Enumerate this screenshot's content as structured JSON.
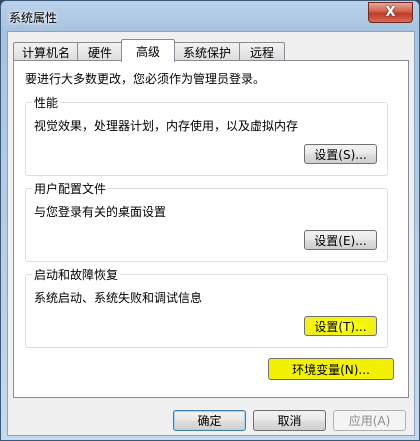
{
  "window": {
    "title": "系统属性",
    "close_glyph": "X"
  },
  "tabs": [
    {
      "label": "计算机名",
      "active": false
    },
    {
      "label": "硬件",
      "active": false
    },
    {
      "label": "高级",
      "active": true
    },
    {
      "label": "系统保护",
      "active": false
    },
    {
      "label": "远程",
      "active": false
    }
  ],
  "advanced": {
    "notice": "要进行大多数更改，您必须作为管理员登录。",
    "performance": {
      "title": "性能",
      "description": "视觉效果，处理器计划，内存使用，以及虚拟内存",
      "button": "设置(S)..."
    },
    "user_profiles": {
      "title": "用户配置文件",
      "description": "与您登录有关的桌面设置",
      "button": "设置(E)..."
    },
    "startup_recovery": {
      "title": "启动和故障恢复",
      "description": "系统启动、系统失败和调试信息",
      "button": "设置(T)..."
    },
    "env_vars_button": "环境变量(N)..."
  },
  "footer": {
    "ok": "确定",
    "cancel": "取消",
    "apply": "应用(A)"
  },
  "colors": {
    "highlight": "#f2f200"
  }
}
